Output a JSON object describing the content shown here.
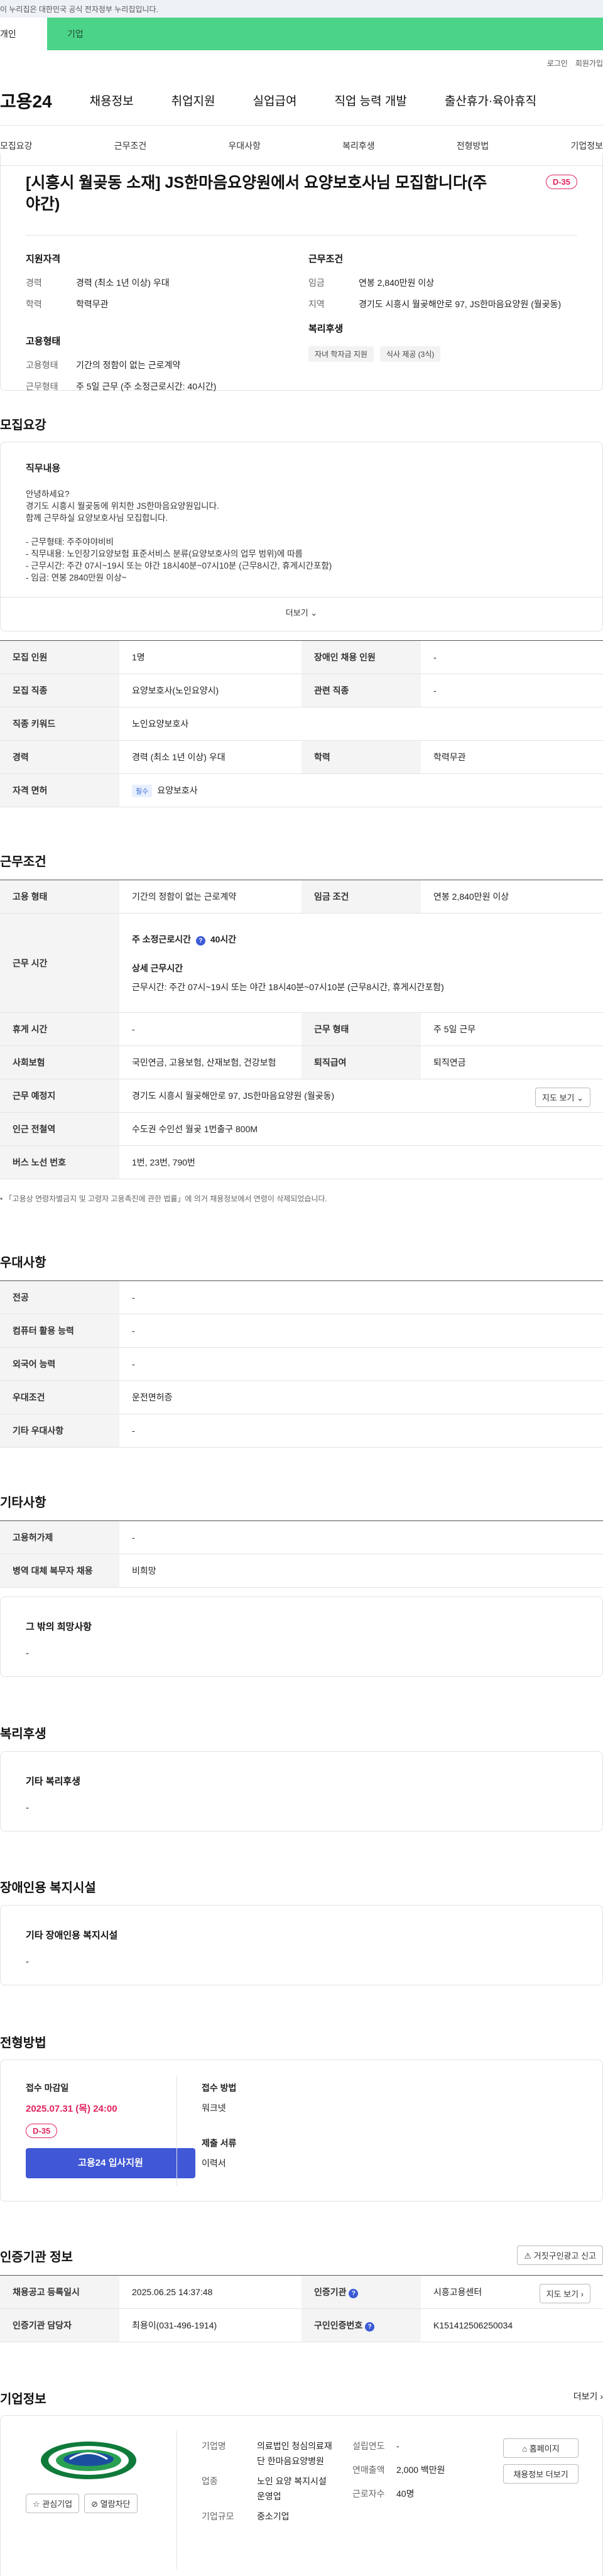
{
  "gov_notice": "이 누리집은 대한민국 공식 전자정부 누리집입니다.",
  "site_tabs": {
    "personal": "개인",
    "company": "기업"
  },
  "util_links": {
    "login": "로그인",
    "signup": "회원가입"
  },
  "gnb": {
    "logo": "고용24",
    "menus": [
      "채용정보",
      "취업지원",
      "실업급여",
      "직업 능력 개발",
      "출산휴가·육아휴직"
    ]
  },
  "section_tabs": [
    "모집요강",
    "근무조건",
    "우대사항",
    "복리후생",
    "전형방법",
    "기업정보"
  ],
  "job": {
    "title": "[시흥시 월곶동 소재] JS한마음요양원에서 요양보호사님 모집합니다(주야간)",
    "dday": "D-35",
    "summary": {
      "qual_title": "지원자격",
      "qual_rows": [
        {
          "k": "경력",
          "v": "경력 (최소 1년 이상) 우대"
        },
        {
          "k": "학력",
          "v": "학력무관"
        }
      ],
      "employ_title": "고용형태",
      "employ_rows": [
        {
          "k": "고용형태",
          "v": "기간의 정함이 없는 근로계약"
        },
        {
          "k": "근무형태",
          "v": "주 5일 근무 (주 소정근로시간: 40시간)"
        }
      ],
      "cond_title": "근무조건",
      "cond_rows": [
        {
          "k": "임금",
          "v": "연봉 2,840만원 이상"
        },
        {
          "k": "지역",
          "v": "경기도 시흥시 월곶해안로 97, JS한마음요양원 (월곶동)"
        }
      ],
      "welfare_title": "복리후생",
      "welfare_chips": [
        "자녀 학자금 지원",
        "식사 제공 (3식)"
      ]
    }
  },
  "recruit": {
    "title": "모집요강",
    "duty_title": "직무내용",
    "duty_lines": [
      "안녕하세요?",
      "경기도 시흥시 월곶동에 위치한 JS한마음요양원입니다.",
      "함께 근무하실 요양보호사님 모집합니다.",
      "",
      "- 근무형태: 주주야야비비",
      "- 직무내용: 노인장기요양보험 표준서비스 분류(요양보호사의 업무 범위)에 따름",
      "- 근무시간: 주간 07시~19시 또는 야간 18시40분~07시10분 (근무8시간, 휴게시간포함)",
      "- 임금: 연봉 2840만원 이상~"
    ],
    "more_label": "더보기",
    "table": {
      "headcount_k": "모집 인원",
      "headcount_v": "1명",
      "disabled_k": "장애인 채용 인원",
      "disabled_v": "-",
      "job_k": "모집 직종",
      "job_v": "요양보호사(노인요양시)",
      "related_k": "관련 직종",
      "related_v": "-",
      "keyword_k": "직종 키워드",
      "keyword_v": "노인요양보호사",
      "career_k": "경력",
      "career_v": "경력 (최소 1년 이상) 우대",
      "edu_k": "학력",
      "edu_v": "학력무관",
      "license_k": "자격 면허",
      "license_tag": "필수",
      "license_v": "요양보호사"
    }
  },
  "work": {
    "title": "근무조건",
    "type_k": "고용 형태",
    "type_v": "기간의 정함이 없는 근로계약",
    "wage_k": "임금 조건",
    "wage_v": "연봉 2,840만원 이상",
    "hours_k": "근무 시간",
    "hours_weekly_label": "주 소정근로시간",
    "hours_weekly_v": "40시간",
    "hours_detail_label": "상세 근무시간",
    "hours_detail_v": "근무시간: 주간 07시~19시 또는 야간 18시40분~07시10분 (근무8시간, 휴게시간포함)",
    "break_k": "휴게 시간",
    "break_v": "-",
    "shape_k": "근무 형태",
    "shape_v": "주 5일 근무",
    "insurance_k": "사회보험",
    "insurance_v": "국민연금, 고용보험, 산재보험, 건강보험",
    "retire_k": "퇴직급여",
    "retire_v": "퇴직연금",
    "place_k": "근무 예정지",
    "place_v": "경기도 시흥시 월곶해안로 97, JS한마음요양원 (월곶동)",
    "map_label": "지도 보기",
    "station_k": "인근 전철역",
    "station_v": "수도권 수인선 월곶 1번출구 800M",
    "bus_k": "버스 노선 번호",
    "bus_v": "1번, 23번, 790번",
    "footnote": "「고용상 연령차별금지 및 고령자 고용촉진에 관한 법률」에 의거 채용정보에서 연령이 삭제되었습니다."
  },
  "prefer": {
    "title": "우대사항",
    "rows": [
      {
        "k": "전공",
        "v": "-"
      },
      {
        "k": "컴퓨터 활용 능력",
        "v": "-"
      },
      {
        "k": "외국어 능력",
        "v": "-"
      },
      {
        "k": "우대조건",
        "v": "운전면허증"
      },
      {
        "k": "기타 우대사항",
        "v": "-"
      }
    ]
  },
  "etc": {
    "title": "기타사항",
    "rows": [
      {
        "k": "고용허가제",
        "v": "-"
      },
      {
        "k": "병역 대체 복무자 채용",
        "v": "비희망"
      }
    ],
    "other_title": "그 밖의 희망사항",
    "other_v": "-"
  },
  "welfare": {
    "title": "복리후생",
    "card_title": "기타 복리후생",
    "card_v": "-"
  },
  "disabled": {
    "title": "장애인용 복지시설",
    "card_title": "기타 장애인용 복지시설",
    "card_v": "-"
  },
  "process": {
    "title": "전형방법",
    "deadline_label": "접수 마감일",
    "deadline_v": "2025.07.31 (목) 24:00",
    "dday": "D-35",
    "apply_label": "고용24 입사지원",
    "method_label": "접수 방법",
    "method_v": "워크넷",
    "docs_label": "제출 서류",
    "docs_v": "이력서"
  },
  "agency": {
    "title": "인증기관 정보",
    "report_label": "거짓구인광고 신고",
    "reg_k": "채용공고 등록일시",
    "reg_v": "2025.06.25 14:37:48",
    "org_k": "인증기관",
    "org_v": "시흥고용센터",
    "map_label": "지도 보기",
    "staff_k": "인증기관 담당자",
    "staff_v": "최용이(031-496-1914)",
    "num_k": "구인인증번호",
    "num_v": "K151412506250034"
  },
  "company": {
    "title": "기업정보",
    "more_label": "더보기",
    "fav_label": "관심기업",
    "block_label": "열람차단",
    "name_k": "기업명",
    "name_v": "의료법인 청심의료재단 한마음요양병원",
    "biz_k": "업종",
    "biz_v": "노인 요양 복지시설 운영업",
    "size_k": "기업규모",
    "size_v": "중소기업",
    "year_k": "설립연도",
    "year_v": "-",
    "sales_k": "연매출액",
    "sales_v": "2,000 백만원",
    "emp_k": "근로자수",
    "emp_v": "40명",
    "home_label": "홈페이지",
    "jobs_label": "채용정보 더보기"
  }
}
